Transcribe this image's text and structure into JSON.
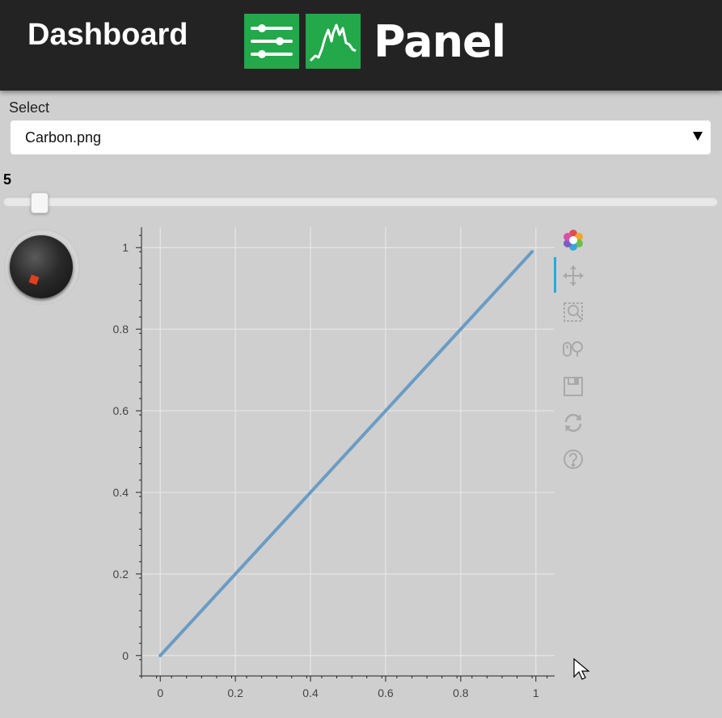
{
  "header": {
    "title": "Dashboard",
    "logo_text": "Panel",
    "bg_color": "#232323",
    "logo_color": "#23a84a"
  },
  "select": {
    "label": "Select",
    "value": "Carbon.png"
  },
  "slider": {
    "value": "5",
    "fraction": 0.05
  },
  "knob": {
    "indicator_color": "#e0401e"
  },
  "toolbar": {
    "tools": [
      "bokeh-logo-icon",
      "pan-icon",
      "box-zoom-icon",
      "wheel-zoom-icon",
      "save-icon",
      "reset-icon",
      "help-icon"
    ],
    "active_color": "#26aae1"
  },
  "chart_data": {
    "type": "line",
    "x": [
      0,
      0.2,
      0.4,
      0.6,
      0.8,
      0.99
    ],
    "y": [
      0,
      0.2,
      0.4,
      0.6,
      0.8,
      0.99
    ],
    "xlim": [
      -0.05,
      1.05
    ],
    "ylim": [
      -0.05,
      1.05
    ],
    "xticks": [
      "0",
      "0.2",
      "0.4",
      "0.6",
      "0.8",
      "1"
    ],
    "yticks": [
      "0",
      "0.2",
      "0.4",
      "0.6",
      "0.8",
      "1"
    ],
    "grid": true,
    "line_color": "#6a9cc4"
  }
}
